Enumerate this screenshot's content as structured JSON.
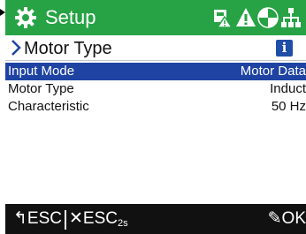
{
  "header": {
    "title": "Setup",
    "icons": [
      "gear-icon",
      "device-warning-icon",
      "warning-triangle-icon",
      "play-circle-icon",
      "network-icon"
    ],
    "color": "#27a345"
  },
  "breadcrumb": {
    "label": "Motor Type",
    "info_label": "i"
  },
  "list": {
    "items": [
      {
        "label": "Input Mode",
        "value": "Motor Data",
        "selected": true
      },
      {
        "label": "Motor Type",
        "value": "Induct",
        "selected": false
      },
      {
        "label": "Characteristic",
        "value": "50 Hz",
        "selected": false
      }
    ]
  },
  "footer": {
    "back_label": "ESC",
    "back_icon": "return-arrow-icon",
    "cancel_label": "ESC",
    "cancel_sub": "2s",
    "cancel_icon": "x-icon",
    "ok_label": "OK",
    "ok_icon": "pencil-icon"
  },
  "colors": {
    "selected_row": "#1f43a3",
    "info_icon": "#1f4ea8",
    "footer": "#111111"
  }
}
